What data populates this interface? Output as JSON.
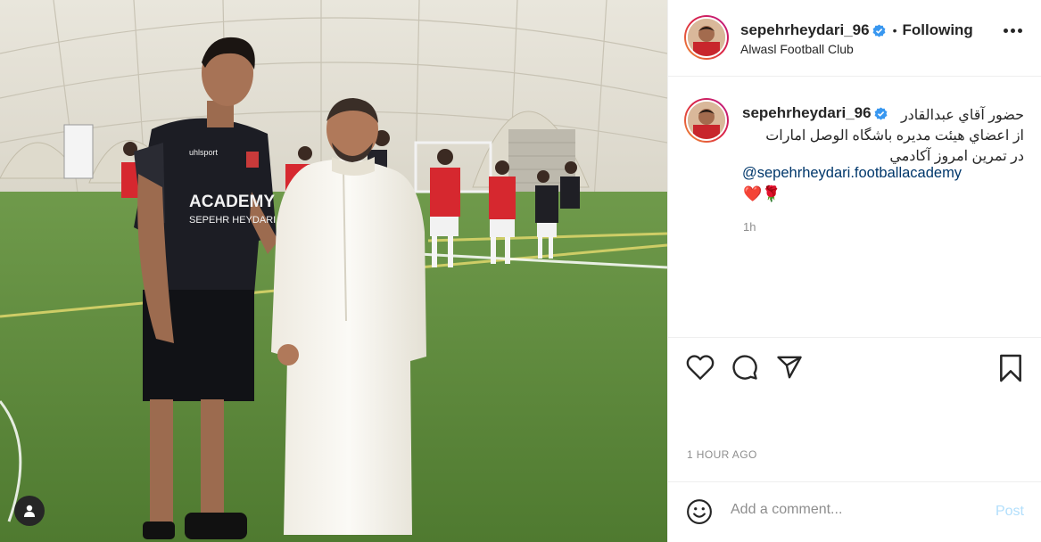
{
  "post": {
    "username": "sepehrheydari_96",
    "follow_state": "Following",
    "location": "Alwasl Football Club",
    "caption_rtl": [
      "حضور آقاي عبدالقادر",
      "از اعضاي هيئت مديره باشگاه الوصل امارات",
      "در تمرين امروز آكادمي"
    ],
    "mention": "@sepehrheydari.footballacademy",
    "emojis": "❤️🌹",
    "time_ago": "1h",
    "date_label": "1 HOUR AGO"
  },
  "comment_box": {
    "placeholder": "Add a comment...",
    "post_label": "Post"
  },
  "photo": {
    "jersey_text_1": "ACADEMY",
    "jersey_text_2": "SEPEHR HEYDARI",
    "brand": "uhlsport"
  },
  "colors": {
    "link": "#00376b",
    "verified": "#3897f0",
    "post_disabled": "#b2dffc",
    "muted": "#8e8e8e"
  },
  "icons": [
    "person-tag-icon",
    "more-options-icon",
    "verified-badge-icon",
    "heart-icon",
    "comment-icon",
    "share-icon",
    "bookmark-icon",
    "emoji-icon"
  ]
}
